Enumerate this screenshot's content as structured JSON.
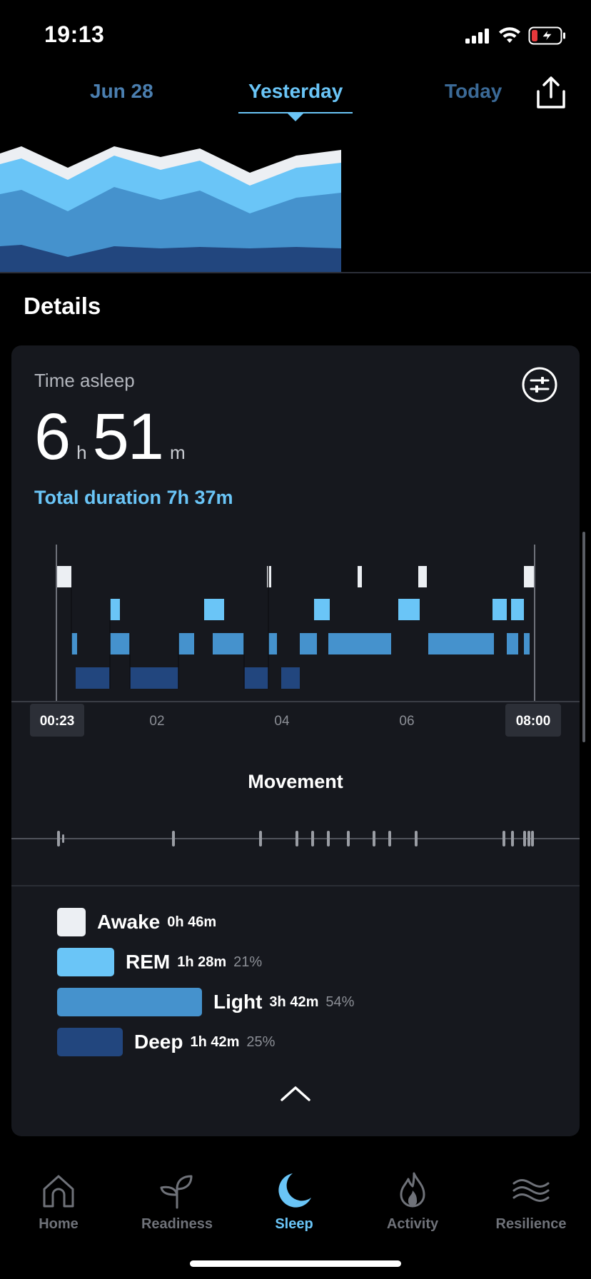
{
  "status_bar": {
    "time": "19:13",
    "icons": [
      "signal-icon",
      "wifi-icon",
      "battery-charging-icon"
    ],
    "battery_color": "#e5383b"
  },
  "date_nav": {
    "tabs": [
      {
        "label": "Jun 28"
      },
      {
        "label": "Yesterday",
        "active": true
      },
      {
        "label": "Today"
      }
    ],
    "share_icon": "share-icon"
  },
  "details": {
    "title": "Details",
    "time_asleep": {
      "label": "Time asleep",
      "hours": "6",
      "hours_unit": "h",
      "minutes": "51",
      "minutes_unit": "m",
      "total_duration": "Total duration 7h 37m"
    },
    "filter_icon": "sliders-icon",
    "hypnogram": {
      "x_ticks": [
        "00:23",
        "02",
        "04",
        "06",
        "08:00"
      ]
    },
    "movement": {
      "title": "Movement"
    },
    "legend": [
      {
        "name": "Awake",
        "duration": "0h 46m",
        "percent": "",
        "color": "#eceff3"
      },
      {
        "name": "REM",
        "duration": "1h 28m",
        "percent": "21%",
        "color": "#6ac5f7"
      },
      {
        "name": "Light",
        "duration": "3h 42m",
        "percent": "54%",
        "color": "#4592cd"
      },
      {
        "name": "Deep",
        "duration": "1h 42m",
        "percent": "25%",
        "color": "#22467e"
      }
    ],
    "collapse_icon": "chevron-up-icon"
  },
  "bottom_nav": {
    "items": [
      {
        "label": "Home",
        "icon": "home-icon"
      },
      {
        "label": "Readiness",
        "icon": "sprout-icon"
      },
      {
        "label": "Sleep",
        "icon": "moon-icon",
        "active": true
      },
      {
        "label": "Activity",
        "icon": "flame-icon"
      },
      {
        "label": "Resilience",
        "icon": "waves-icon"
      }
    ]
  },
  "colors": {
    "accent": "#6ac5f7",
    "awake": "#eceff3",
    "rem": "#6ac5f7",
    "light": "#4592cd",
    "deep": "#22467e",
    "card": "#16181e"
  }
}
